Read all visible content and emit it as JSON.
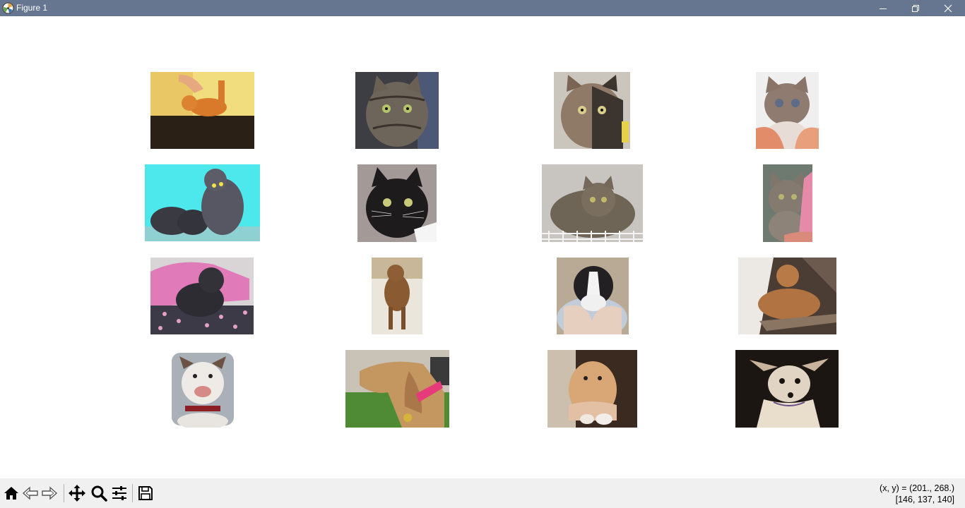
{
  "window": {
    "title": "Figure 1",
    "controls": [
      "minimize",
      "maximize",
      "close"
    ]
  },
  "figure": {
    "rows": 4,
    "columns": 4,
    "images": [
      {
        "subject": "cat",
        "icon": "cat-photo-icon"
      },
      {
        "subject": "cat",
        "icon": "cat-photo-icon"
      },
      {
        "subject": "cat",
        "icon": "cat-photo-icon"
      },
      {
        "subject": "cat",
        "icon": "cat-photo-icon"
      },
      {
        "subject": "cat",
        "icon": "cat-photo-icon"
      },
      {
        "subject": "cat",
        "icon": "cat-photo-icon"
      },
      {
        "subject": "cat",
        "icon": "cat-photo-icon"
      },
      {
        "subject": "cat",
        "icon": "cat-photo-icon"
      },
      {
        "subject": "dog",
        "icon": "dog-photo-icon"
      },
      {
        "subject": "dog",
        "icon": "dog-photo-icon"
      },
      {
        "subject": "dog",
        "icon": "dog-photo-icon"
      },
      {
        "subject": "dog",
        "icon": "dog-photo-icon"
      },
      {
        "subject": "dog",
        "icon": "dog-photo-icon"
      },
      {
        "subject": "dog",
        "icon": "dog-photo-icon"
      },
      {
        "subject": "dog",
        "icon": "dog-photo-icon"
      },
      {
        "subject": "dog",
        "icon": "dog-photo-icon"
      }
    ]
  },
  "toolbar": {
    "tools": [
      "home-icon",
      "back-icon",
      "forward-icon",
      "pan-icon",
      "zoom-icon",
      "configure-subplots-icon",
      "save-icon"
    ]
  },
  "status": {
    "coords": "(x, y) = (201., 268.)",
    "pixel": "[146, 137, 140]"
  }
}
